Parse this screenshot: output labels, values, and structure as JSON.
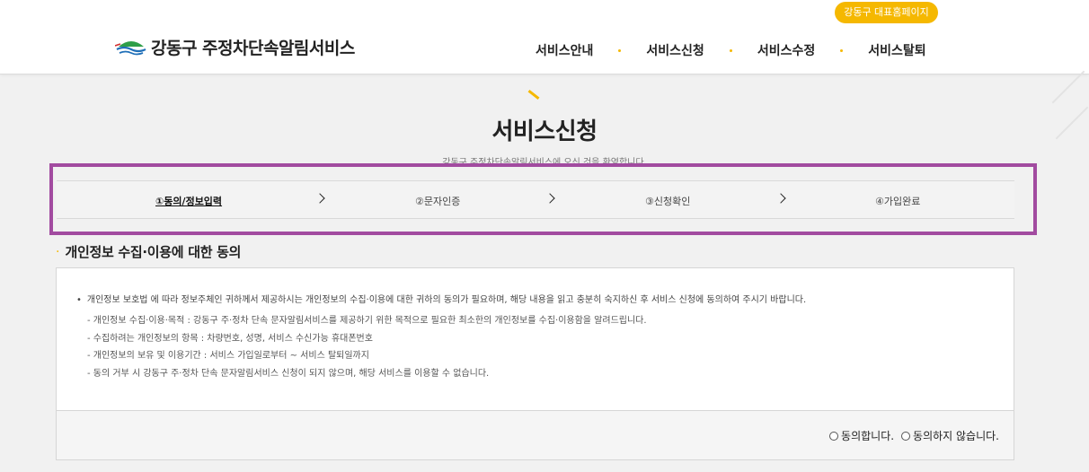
{
  "header": {
    "home_link": "강동구 대표홈페이지",
    "logo_text": "강동구 주정차단속알림서비스",
    "nav": [
      "서비스안내",
      "서비스신청",
      "서비스수정",
      "서비스탈퇴"
    ],
    "accent_color": "#f5b800"
  },
  "page": {
    "title": "서비스신청",
    "subtitle": "강동구 주정차단속알림서비스에 오신 것을 환영합니다."
  },
  "steps": {
    "items": [
      "①동의/정보입력",
      "②문자인증",
      "③신청확인",
      "④가입완료"
    ],
    "active_index": 0,
    "highlight_color": "#a24ba0"
  },
  "consent": {
    "section_title": "개인정보 수집·이용에 대한 동의",
    "lead": "개인정보 보호법 에 따라 정보주체인 귀하께서 제공하시는 개인정보의 수집·이용에 대한 귀하의 동의가 필요하며, 해당 내용을 읽고 충분히 숙지하신 후 서비스 신청에 동의하여 주시기 바랍니다.",
    "items": [
      "- 개인정보 수집·이용·목적 : 강동구 주·정차 단속 문자알림서비스를 제공하기 위한 목적으로 필요한 최소한의 개인정보를 수집·이용함을 알려드립니다.",
      "- 수집하려는 개인정보의 항목 : 차량번호, 성명, 서비스 수신가능 휴대폰번호",
      "- 개인정보의 보유 및 이용기간 : 서비스 가입일로부터 ~ 서비스 탈퇴일까지",
      "- 동의 거부 시 강동구 주·정차 단속 문자알림서비스 신청이 되지 않으며, 해당 서비스를 이용할 수 없습니다."
    ],
    "agree_label": "동의합니다.",
    "disagree_label": "동의하지 않습니다."
  }
}
